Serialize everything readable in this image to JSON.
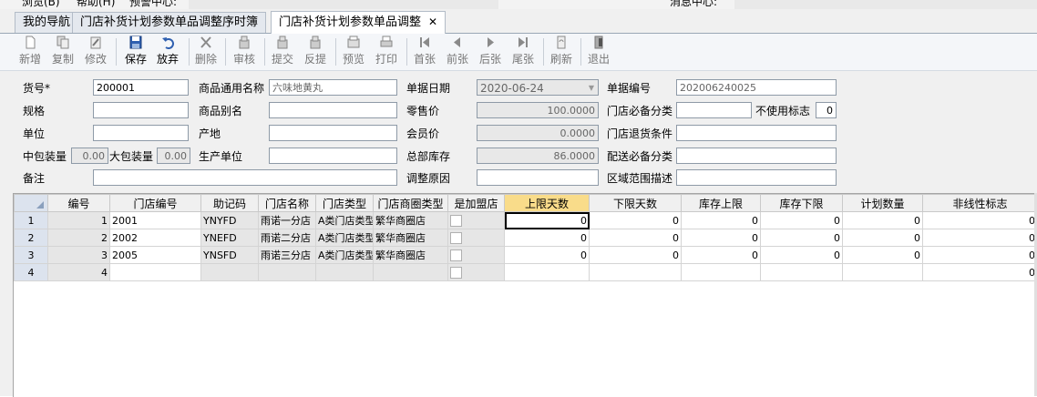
{
  "topmenu": [
    "浏览(B)",
    "帮助(H)",
    "预警中心:",
    "消息中心:"
  ],
  "tabs": [
    {
      "label": "我的导航",
      "active": false
    },
    {
      "label": "门店补货计划参数单品调整序时簿",
      "active": false
    },
    {
      "label": "门店补货计划参数单品调整",
      "active": true,
      "close": "✕"
    }
  ],
  "toolbar": [
    {
      "label": "新增",
      "icon": "new-icon",
      "enabled": false
    },
    {
      "label": "复制",
      "icon": "copy-icon",
      "enabled": false
    },
    {
      "label": "修改",
      "icon": "edit-icon",
      "enabled": false
    },
    {
      "label": "保存",
      "icon": "save-icon",
      "enabled": true
    },
    {
      "label": "放弃",
      "icon": "undo-icon",
      "enabled": true
    },
    {
      "label": "删除",
      "icon": "delete-icon",
      "enabled": false
    },
    {
      "label": "审核",
      "icon": "audit-icon",
      "enabled": false
    },
    {
      "label": "提交",
      "icon": "submit-icon",
      "enabled": false
    },
    {
      "label": "反提",
      "icon": "unsubmit-icon",
      "enabled": false
    },
    {
      "label": "预览",
      "icon": "preview-icon",
      "enabled": false
    },
    {
      "label": "打印",
      "icon": "print-icon",
      "enabled": false
    },
    {
      "label": "首张",
      "icon": "first-icon",
      "enabled": false
    },
    {
      "label": "前张",
      "icon": "prev-icon",
      "enabled": false
    },
    {
      "label": "后张",
      "icon": "next-icon",
      "enabled": false
    },
    {
      "label": "尾张",
      "icon": "last-icon",
      "enabled": false
    },
    {
      "label": "刷新",
      "icon": "refresh-icon",
      "enabled": false
    },
    {
      "label": "退出",
      "icon": "exit-icon",
      "enabled": false
    }
  ],
  "form": {
    "item_no_label": "货号*",
    "item_no": "200001",
    "generic_name_label": "商品通用名称",
    "generic_name": "六味地黄丸",
    "doc_date_label": "单据日期",
    "doc_date": "2020-06-24",
    "doc_no_label": "单据编号",
    "doc_no": "202006240025",
    "spec_label": "规格",
    "spec": "",
    "alias_label": "商品别名",
    "alias": "",
    "retail_price_label": "零售价",
    "retail_price": "100.0000",
    "must_cat_label": "门店必备分类",
    "must_cat": "",
    "unused_label": "不使用标志",
    "unused": "0",
    "unit_label": "单位",
    "unit": "",
    "origin_label": "产地",
    "origin": "",
    "member_price_label": "会员价",
    "member_price": "0.0000",
    "return_cond_label": "门店退货条件",
    "return_cond": "",
    "mid_pack_label": "中包装量",
    "mid_pack": "0.00",
    "big_pack_label": "大包装量",
    "big_pack": "0.00",
    "maker_label": "生产单位",
    "maker": "",
    "total_stock_label": "总部库存",
    "total_stock": "86.0000",
    "dist_cat_label": "配送必备分类",
    "dist_cat": "",
    "remark_label": "备注",
    "remark": "",
    "reason_label": "调整原因",
    "reason": "",
    "region_label": "区域范围描述",
    "region": ""
  },
  "grid": {
    "columns": [
      "编号",
      "门店编号",
      "助记码",
      "门店名称",
      "门店类型",
      "门店商圈类型",
      "是加盟店",
      "上限天数",
      "下限天数",
      "库存上限",
      "库存下限",
      "计划数量",
      "非线性标志"
    ],
    "rows": [
      {
        "rn": "1",
        "no": "1",
        "store": "2001",
        "code": "YNYFD",
        "name": "雨诺一分店",
        "type": "A类门店类型",
        "area": "繁华商圈店",
        "upper": "0",
        "lower": "0",
        "smax": "0",
        "smin": "0",
        "plan": "0",
        "nl": "0"
      },
      {
        "rn": "2",
        "no": "2",
        "store": "2002",
        "code": "YNEFD",
        "name": "雨诺二分店",
        "type": "A类门店类型",
        "area": "繁华商圈店",
        "upper": "0",
        "lower": "0",
        "smax": "0",
        "smin": "0",
        "plan": "0",
        "nl": "0"
      },
      {
        "rn": "3",
        "no": "3",
        "store": "2005",
        "code": "YNSFD",
        "name": "雨诺三分店",
        "type": "A类门店类型",
        "area": "繁华商圈店",
        "upper": "0",
        "lower": "0",
        "smax": "0",
        "smin": "0",
        "plan": "0",
        "nl": "0"
      },
      {
        "rn": "4",
        "no": "4",
        "store": "",
        "code": "",
        "name": "",
        "type": "",
        "area": "",
        "upper": "",
        "lower": "",
        "smax": "",
        "smin": "",
        "plan": "",
        "nl": "0"
      }
    ]
  }
}
